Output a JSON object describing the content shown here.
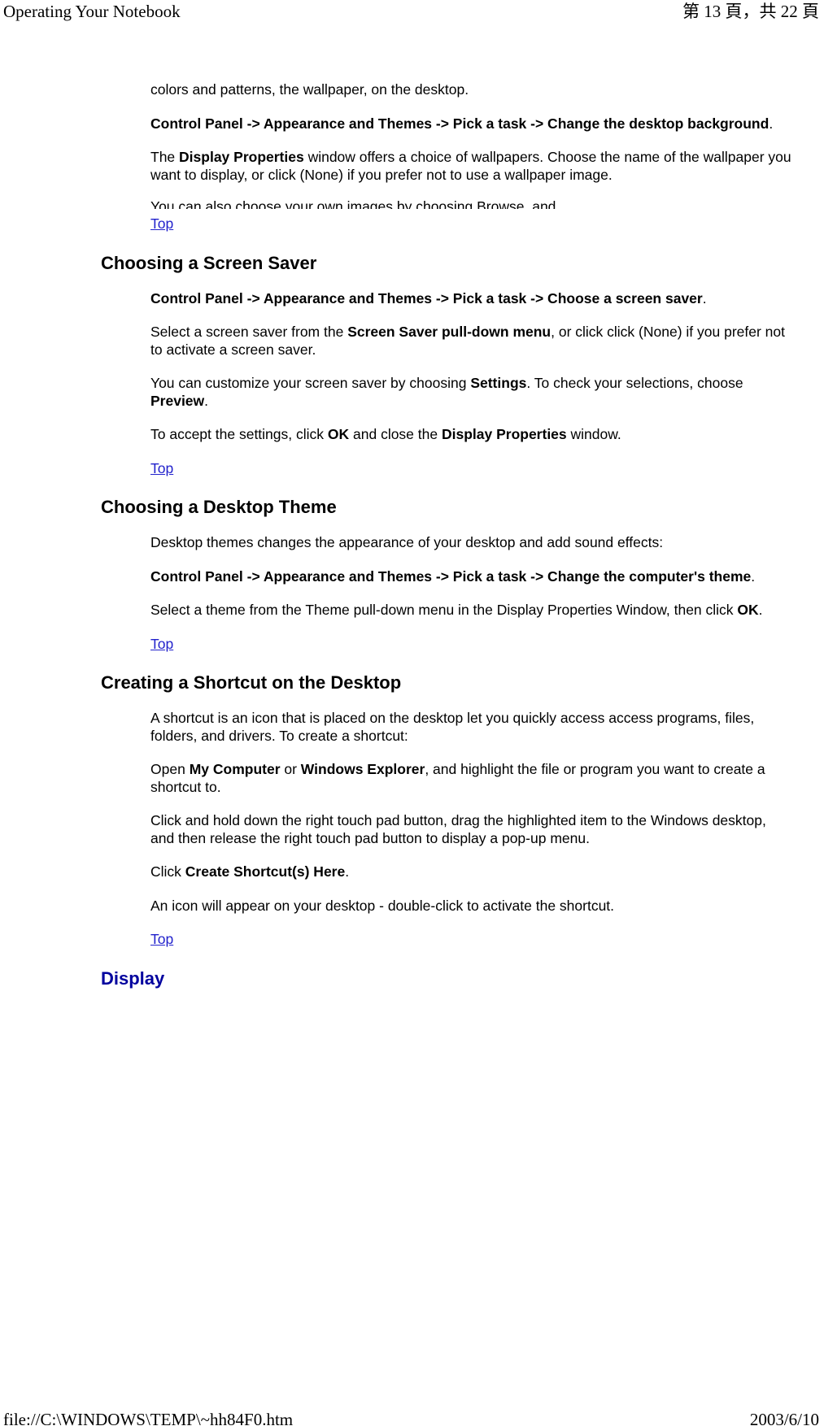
{
  "header": {
    "title": "Operating Your Notebook",
    "page_indicator": "第 13 頁，共 22 頁"
  },
  "footer": {
    "file_path": "file://C:\\WINDOWS\\TEMP\\~hh84F0.htm",
    "date": "2003/6/10"
  },
  "colors": {
    "link": "#2222cc",
    "blue_heading": "#00009e",
    "text": "#000000",
    "background": "#ffffff"
  },
  "content": {
    "continued_paragraph": "colors and patterns, the wallpaper, on the desktop.",
    "wallpaper_path": {
      "bold": "Control Panel -> Appearance and Themes -> Pick a task -> Change the desktop background",
      "tail": "."
    },
    "display_properties_paragraph": {
      "pre": "The ",
      "bold": "Display Properties",
      "post": " window offers a choice of wallpapers. Choose the name of the wallpaper you want to display, or click (None) if you prefer not to use a wallpaper image."
    },
    "clipped_line": "You can also choose your own images by choosing Browse, and",
    "top_link_1": "Top",
    "screen_saver_heading": "Choosing a Screen Saver",
    "screen_saver_path": {
      "bold": "Control Panel -> Appearance and Themes -> Pick a task -> Choose a screen saver",
      "tail": "."
    },
    "screen_saver_select": {
      "pre": "Select a screen saver from the ",
      "bold": "Screen Saver pull-down menu",
      "post": ", or click click (None) if you prefer not to activate a screen saver."
    },
    "screen_saver_customize": {
      "pre": "You can customize your screen saver by choosing ",
      "bold1": "Settings",
      "mid": ". To check your selections, choose ",
      "bold2": "Preview",
      "post": "."
    },
    "screen_saver_accept": {
      "pre": "To accept the settings, click ",
      "bold1": "OK",
      "mid": " and close the ",
      "bold2": "Display Properties",
      "post": " window."
    },
    "top_link_2": "Top",
    "desktop_theme_heading": "Choosing a Desktop Theme",
    "desktop_theme_intro": "Desktop themes changes the appearance of your desktop and add sound effects:",
    "desktop_theme_path": {
      "bold": "Control Panel -> Appearance and Themes -> Pick a task -> Change the computer's theme",
      "tail": "."
    },
    "desktop_theme_select": {
      "pre": "Select a theme from the Theme pull-down menu in the Display Properties Window, then click ",
      "bold": "OK",
      "post": "."
    },
    "top_link_3": "Top",
    "shortcut_heading": "Creating a Shortcut on the Desktop",
    "shortcut_intro": "A shortcut is an icon that is placed on the desktop let you quickly access access programs, files, folders, and drivers. To create a shortcut:",
    "shortcut_open": {
      "pre": "Open ",
      "bold1": "My Computer",
      "mid": " or ",
      "bold2": "Windows Explorer",
      "post": ", and highlight the file or program you want to create a shortcut to."
    },
    "shortcut_drag": "Click and hold down the right touch pad button, drag the highlighted item to the Windows desktop, and then release the right touch pad button to display a pop-up menu.",
    "shortcut_click": {
      "pre": "Click ",
      "bold": "Create Shortcut(s) Here",
      "post": "."
    },
    "shortcut_icon": "An icon will appear on your desktop - double-click to activate the shortcut.",
    "top_link_4": "Top",
    "display_heading": "Display"
  }
}
